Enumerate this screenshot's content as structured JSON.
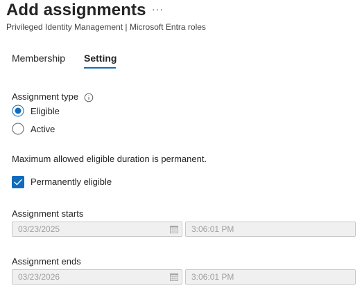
{
  "header": {
    "title": "Add assignments",
    "more_label": "···",
    "subtitle": "Privileged Identity Management | Microsoft Entra roles"
  },
  "tabs": [
    {
      "label": "Membership",
      "selected": false
    },
    {
      "label": "Setting",
      "selected": true
    }
  ],
  "assignment_type": {
    "label": "Assignment type",
    "info_icon": "info-icon",
    "options": [
      {
        "label": "Eligible",
        "checked": true
      },
      {
        "label": "Active",
        "checked": false
      }
    ]
  },
  "duration_note": "Maximum allowed eligible duration is permanent.",
  "permanent": {
    "label": "Permanently eligible",
    "checked": true
  },
  "starts": {
    "label": "Assignment starts",
    "date": "03/23/2025",
    "time": "3:06:01 PM"
  },
  "ends": {
    "label": "Assignment ends",
    "date": "03/23/2026",
    "time": "3:06:01 PM"
  },
  "colors": {
    "accent": "#0f6cbd",
    "disabled_field_bg": "#f0f0f0",
    "disabled_text": "#a0a0a0"
  }
}
